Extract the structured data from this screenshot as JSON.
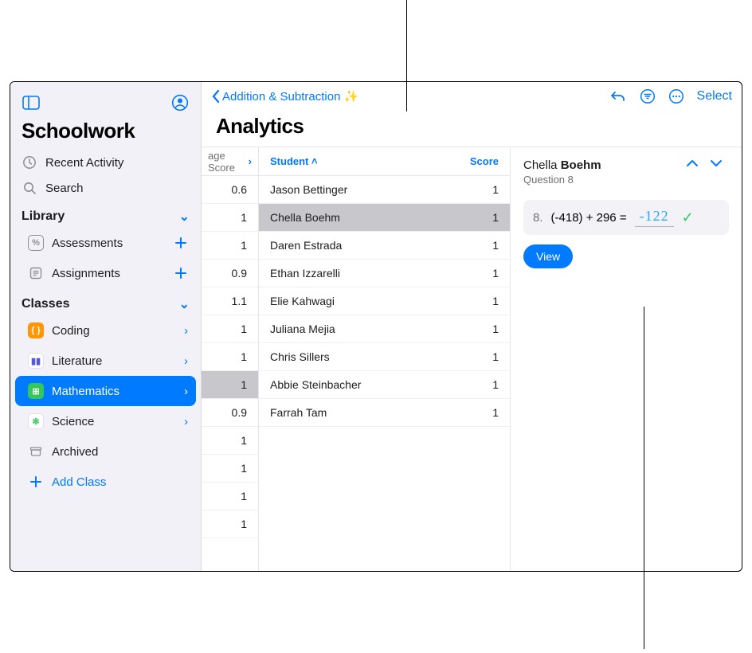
{
  "sidebar": {
    "appTitle": "Schoolwork",
    "recent": "Recent Activity",
    "search": "Search",
    "librarySection": "Library",
    "assessments": "Assessments",
    "assignments": "Assignments",
    "classesSection": "Classes",
    "classes": [
      "Coding",
      "Literature",
      "Mathematics",
      "Science",
      "Archived"
    ],
    "activeClassIndex": 2,
    "addClass": "Add Class"
  },
  "header": {
    "backLabel": "Addition & Subtraction ✨",
    "title": "Analytics",
    "selectLabel": "Select"
  },
  "strip": {
    "headLabel": "age Score",
    "values": [
      0.6,
      1,
      1,
      0.9,
      1.1,
      1,
      1,
      1,
      0.9,
      1,
      1,
      1,
      1
    ],
    "selectedIndex": 7
  },
  "students": {
    "colStudent": "Student",
    "colScore": "Score",
    "rows": [
      {
        "name": "Jason Bettinger",
        "score": 1
      },
      {
        "name": "Chella Boehm",
        "score": 1
      },
      {
        "name": "Daren Estrada",
        "score": 1
      },
      {
        "name": "Ethan Izzarelli",
        "score": 1
      },
      {
        "name": "Elie Kahwagi",
        "score": 1
      },
      {
        "name": "Juliana Mejia",
        "score": 1
      },
      {
        "name": "Chris Sillers",
        "score": 1
      },
      {
        "name": "Abbie Steinbacher",
        "score": 1
      },
      {
        "name": "Farrah Tam",
        "score": 1
      }
    ],
    "selectedIndex": 1
  },
  "detail": {
    "first": "Chella",
    "last": "Boehm",
    "question": "Question 8",
    "qnum": "8.",
    "qtext": "(-418) + 296 =",
    "answer": "-122",
    "viewLabel": "View"
  }
}
